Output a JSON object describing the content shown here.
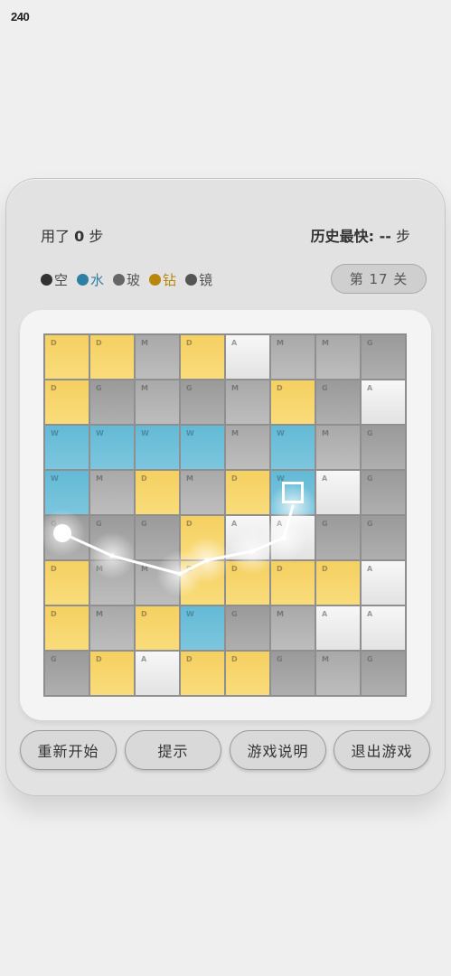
{
  "status_bar": {
    "time": "240"
  },
  "stats": {
    "steps_prefix": "用了 ",
    "steps_value": "0",
    "steps_suffix": " 步",
    "best_prefix": "历史最快: ",
    "best_value": "--",
    "best_suffix": " 步"
  },
  "legend": [
    {
      "label": "空",
      "color": "#333333",
      "text_color": "#444444"
    },
    {
      "label": "水",
      "color": "#2e7fa3",
      "text_color": "#2e7fa3"
    },
    {
      "label": "玻",
      "color": "#666666",
      "text_color": "#555555"
    },
    {
      "label": "钻",
      "color": "#b8860b",
      "text_color": "#b8860b"
    },
    {
      "label": "镜",
      "color": "#555555",
      "text_color": "#555555"
    }
  ],
  "level": {
    "text": "第 17 关"
  },
  "board": {
    "rows": [
      [
        "D",
        "D",
        "M",
        "D",
        "A",
        "M",
        "M",
        "G"
      ],
      [
        "D",
        "G",
        "M",
        "G",
        "M",
        "D",
        "G",
        "A"
      ],
      [
        "W",
        "W",
        "W",
        "W",
        "M",
        "W",
        "M",
        "G"
      ],
      [
        "W",
        "M",
        "D",
        "M",
        "D",
        "W",
        "A",
        "G"
      ],
      [
        "G",
        "G",
        "G",
        "D",
        "A",
        "A",
        "G",
        "G"
      ],
      [
        "D",
        "M",
        "M",
        "D",
        "D",
        "D",
        "D",
        "A"
      ],
      [
        "D",
        "M",
        "D",
        "W",
        "G",
        "M",
        "A",
        "A"
      ],
      [
        "G",
        "D",
        "A",
        "D",
        "D",
        "G",
        "M",
        "G"
      ]
    ],
    "legend_codes": {
      "A": "空",
      "W": "水",
      "G": "玻",
      "D": "钻",
      "M": "镜"
    },
    "path": {
      "start_cell": {
        "row": 3.9,
        "col": -0.1
      },
      "target_cell": {
        "row": 3,
        "col": 5
      },
      "points": [
        {
          "row": 3.9,
          "col": -0.1
        },
        {
          "row": 4.4,
          "col": 1.0
        },
        {
          "row": 4.8,
          "col": 2.5
        },
        {
          "row": 4.5,
          "col": 3.1
        },
        {
          "row": 4.3,
          "col": 4.1
        },
        {
          "row": 4.0,
          "col": 4.8
        },
        {
          "row": 3.3,
          "col": 5.0
        }
      ]
    }
  },
  "buttons": {
    "restart": "重新开始",
    "hint": "提示",
    "instructions": "游戏说明",
    "exit": "退出游戏"
  }
}
